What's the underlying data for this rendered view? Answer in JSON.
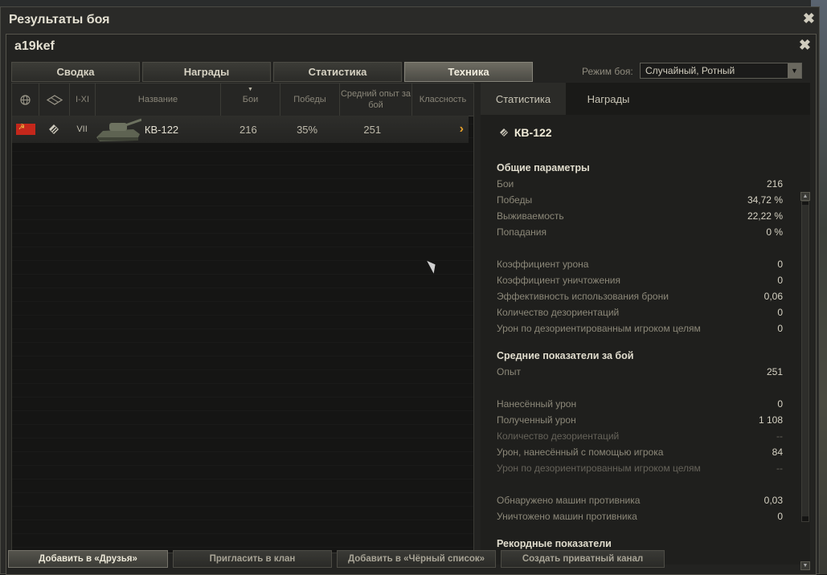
{
  "outer": {
    "title": "Результаты боя",
    "close": "✖"
  },
  "inner": {
    "title": "a19kef",
    "close": "✖"
  },
  "tabs": [
    {
      "label": "Сводка"
    },
    {
      "label": "Награды"
    },
    {
      "label": "Статистика"
    },
    {
      "label": "Техника"
    }
  ],
  "mode": {
    "label": "Режим боя:",
    "value": "Случайный, Ротный"
  },
  "table": {
    "headers": {
      "name": "Название",
      "battles": "Бои",
      "wins": "Победы",
      "avg_xp": "Средний опыт за бой",
      "class": "Классность",
      "tier": "I-XI"
    },
    "rows": [
      {
        "tier": "VII",
        "name": "КВ-122",
        "battles": "216",
        "wins": "35%",
        "avg_xp": "251",
        "arrow": "›"
      }
    ]
  },
  "right": {
    "tabs": [
      {
        "label": "Статистика"
      },
      {
        "label": "Награды"
      }
    ],
    "vehicle": "КВ-122",
    "sections": {
      "general": "Общие параметры",
      "average": "Средние показатели за бой",
      "records": "Рекордные показатели"
    },
    "general": [
      {
        "label": "Бои",
        "value": "216"
      },
      {
        "label": "Победы",
        "value": "34,72 %"
      },
      {
        "label": "Выживаемость",
        "value": "22,22 %"
      },
      {
        "label": "Попадания",
        "value": "0 %"
      }
    ],
    "general2": [
      {
        "label": "Коэффициент урона",
        "value": "0"
      },
      {
        "label": "Коэффициент уничтожения",
        "value": "0"
      },
      {
        "label": "Эффективность использования брони",
        "value": "0,06"
      },
      {
        "label": "Количество дезориентаций",
        "value": "0"
      },
      {
        "label": "Урон по дезориентированным игроком целям",
        "value": "0"
      }
    ],
    "average": [
      {
        "label": "Опыт",
        "value": "251"
      }
    ],
    "average2": [
      {
        "label": "Нанесённый урон",
        "value": "0"
      },
      {
        "label": "Полученный урон",
        "value": "1 108"
      },
      {
        "label": "Количество дезориентаций",
        "value": "--"
      },
      {
        "label": "Урон, нанесённый с помощью игрока",
        "value": "84"
      },
      {
        "label": "Урон по дезориентированным игроком целям",
        "value": "--"
      }
    ],
    "average3": [
      {
        "label": "Обнаружено машин противника",
        "value": "0,03"
      },
      {
        "label": "Уничтожено машин противника",
        "value": "0"
      }
    ]
  },
  "footer": [
    {
      "label": "Добавить в «Друзья»"
    },
    {
      "label": "Пригласить в клан"
    },
    {
      "label": "Добавить в «Чёрный список»"
    },
    {
      "label": "Создать приватный канал"
    }
  ]
}
